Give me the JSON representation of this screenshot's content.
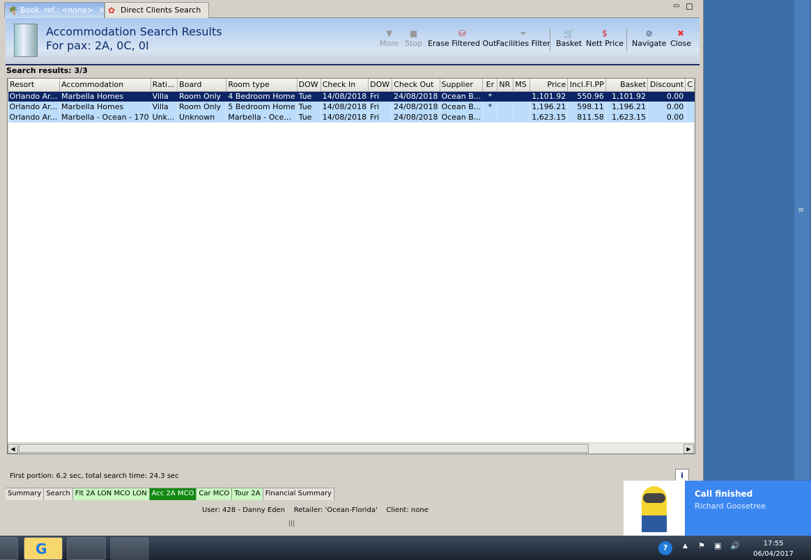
{
  "tabs": [
    {
      "label": "Book. ref.: <none>"
    },
    {
      "label": "Direct Clients Search"
    }
  ],
  "header": {
    "title": "Accommodation Search Results",
    "subtitle": "For pax: 2A, 0C, 0I"
  },
  "toolbar": {
    "more": "More",
    "stop": "Stop",
    "erase": "Erase Filtered Out",
    "facilities": "Facilities Filter",
    "basket": "Basket",
    "nett": "Nett Price",
    "navigate": "Navigate",
    "close": "Close"
  },
  "results_label": "Search results: 3/3",
  "columns": [
    "Resort",
    "Accommodation",
    "Rati...",
    "Board",
    "Room type",
    "DOW",
    "Check In",
    "DOW",
    "Check Out",
    "Supplier",
    "Er",
    "NR",
    "MS",
    "Price",
    "Incl.Fl.PP",
    "Basket",
    "Discount",
    "C"
  ],
  "rows": [
    [
      "Orlando Ar...",
      "Marbella Homes",
      "Villa",
      "Room Only",
      "4 Bedroom Home",
      "Tue",
      "14/08/2018",
      "Fri",
      "24/08/2018",
      "Ocean B...",
      "*",
      "",
      "",
      "1,101.92",
      "550.96",
      "1,101.92",
      "0.00",
      ""
    ],
    [
      "Orlando Ar...",
      "Marbella Homes",
      "Villa",
      "Room Only",
      "5 Bedroom Home",
      "Tue",
      "14/08/2018",
      "Fri",
      "24/08/2018",
      "Ocean B...",
      "*",
      "",
      "",
      "1,196.21",
      "598.11",
      "1,196.21",
      "0.00",
      ""
    ],
    [
      "Orlando Ar...",
      "Marbella - Ocean - 170",
      "Unk...",
      "Unknown",
      "Marbella - Oce...",
      "Tue",
      "14/08/2018",
      "Fri",
      "24/08/2018",
      "Ocean B...",
      "",
      "",
      "",
      "1,623.15",
      "811.58",
      "1,623.15",
      "0.00",
      ""
    ]
  ],
  "timing": "First portion: 6.2 sec, total search time: 24.3 sec",
  "info": "i",
  "bottom_tabs": [
    "Summary",
    "Search",
    "Flt 2A LON MCO LON",
    "Acc 2A MCO",
    "Car MCO",
    "Tour 2A",
    "Financial Summary"
  ],
  "status": "User: 428 - Danny Eden    Retailer: 'Ocean-Florida'    Client: none",
  "notification": {
    "title": "Call finished",
    "caller": "Richard Goosetree"
  },
  "clock": {
    "time": "17:55",
    "date": "06/04/2017"
  }
}
